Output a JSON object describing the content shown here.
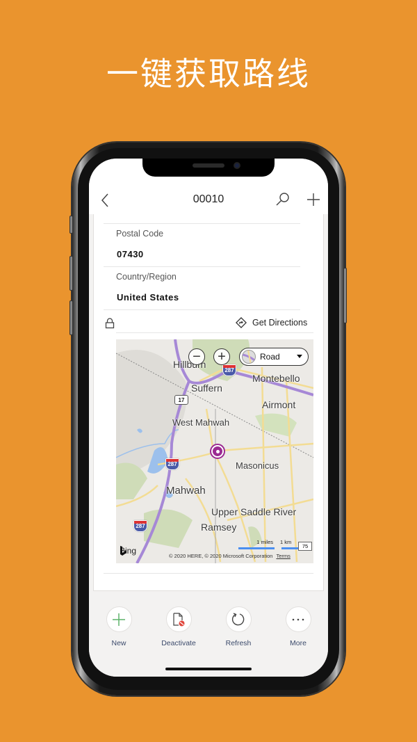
{
  "promo": {
    "headline": "一键获取路线"
  },
  "header": {
    "title": "00010",
    "back_icon": "chevron-left-icon",
    "search_icon": "search-icon",
    "add_icon": "plus-icon"
  },
  "fields": [
    {
      "label": "Postal Code",
      "value": "07430"
    },
    {
      "label": "Country/Region",
      "value": "United States"
    }
  ],
  "map_section": {
    "lock_icon": "lock-icon",
    "directions_label": "Get Directions",
    "directions_icon": "directions-icon"
  },
  "map": {
    "zoom_out": "−",
    "zoom_in": "+",
    "style_selected": "Road",
    "places": [
      "Hillburn",
      "Suffern",
      "Montebello",
      "Airmont",
      "West Mahwah",
      "Masonicus",
      "Mahwah",
      "Upper Saddle River",
      "Ramsey"
    ],
    "highway_shields": [
      "287",
      "287",
      "287"
    ],
    "route_sign": "17",
    "provider": "Bing",
    "copyright": "© 2020 HERE, © 2020 Microsoft Corporation",
    "terms": "Terms",
    "scale_miles": "1 miles",
    "scale_km": "1 km",
    "scale_box": "75",
    "pin_color": "#9B2A92"
  },
  "command_bar": {
    "items": [
      {
        "label": "New",
        "icon": "plus-icon"
      },
      {
        "label": "Deactivate",
        "icon": "deactivate-document-icon"
      },
      {
        "label": "Refresh",
        "icon": "refresh-icon"
      },
      {
        "label": "More",
        "icon": "more-icon"
      }
    ]
  },
  "colors": {
    "background": "#EA942E",
    "accent_green": "#5DB36A",
    "label_blue": "#3B4A6B",
    "route_purple": "#A688D6"
  }
}
